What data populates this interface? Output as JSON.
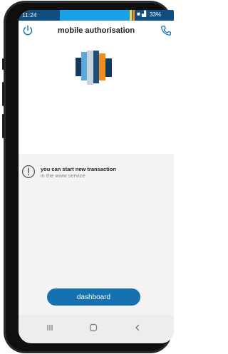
{
  "status_bar": {
    "time": "11:24",
    "signal": "■ ▟",
    "battery": "33%"
  },
  "header": {
    "title": "mobile authorisation"
  },
  "icons": {
    "power": "power-icon",
    "phone": "phone-icon",
    "info": "info-icon",
    "logo": "brand-logo"
  },
  "message": {
    "line1": "you can start new transaction",
    "line2": "in the www service"
  },
  "actions": {
    "dashboard_label": "dashboard"
  },
  "colors": {
    "accent": "#1571b0",
    "status_bar": "#0f4f82",
    "logo": [
      "#123a5c",
      "#5ea8d8",
      "#1d4f7a",
      "#c6d4de",
      "#f08d1c",
      "#123a5c"
    ]
  }
}
